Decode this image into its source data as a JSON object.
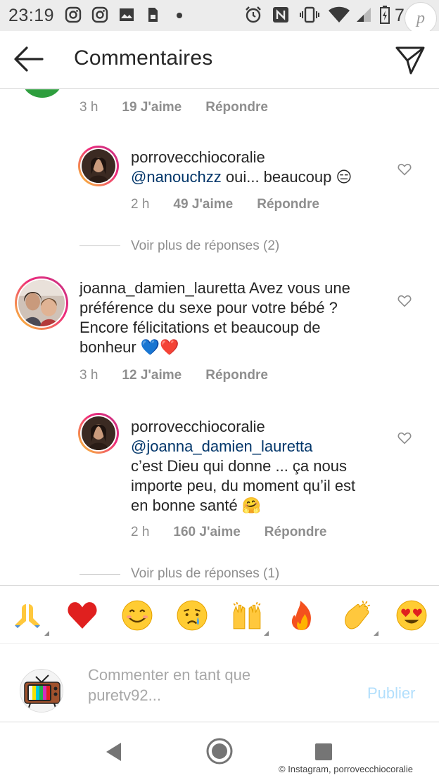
{
  "status_bar": {
    "time": "23:19",
    "battery_percent": "7",
    "icons": [
      "instagram-icon",
      "instagram-icon",
      "image-icon",
      "sim-icon",
      "dot-icon",
      "alarm-icon",
      "nfc-icon",
      "vibrate-icon",
      "wifi-icon",
      "signal-icon",
      "battery-icon"
    ],
    "watermark": "p"
  },
  "header": {
    "title": "Commentaires",
    "back_icon": "arrow-left-icon",
    "send_icon": "paper-plane-icon"
  },
  "comments": [
    {
      "kind": "partial",
      "time": "3 h",
      "likes": "19 J'aime",
      "reply": "Répondre"
    },
    {
      "kind": "reply",
      "username": "porrovecchiocoralie",
      "mention": "@nanouchzz",
      "text": " oui... beaucoup 😑",
      "time": "2 h",
      "likes": "49 J'aime",
      "reply": "Répondre"
    },
    {
      "kind": "more",
      "label": "Voir plus de réponses (2)"
    },
    {
      "kind": "top",
      "username": "joanna_damien_lauretta",
      "text_line1": " Avez vous une",
      "text_line2": "préférence du sexe pour votre bébé ?",
      "text_line3": "Encore félicitations et beaucoup de",
      "text_line4": "bonheur 💙❤️",
      "time": "3 h",
      "likes": "12 J'aime",
      "reply": "Répondre"
    },
    {
      "kind": "reply",
      "username": "porrovecchiocoralie",
      "mention": "@joanna_damien_lauretta",
      "text_line1": "c’est Dieu qui donne ... ça nous",
      "text_line2": "importe peu, du moment qu’il est",
      "text_line3": "en bonne santé 🤗",
      "time": "2 h",
      "likes": "160 J'aime",
      "reply": "Répondre"
    },
    {
      "kind": "more",
      "label": "Voir plus de réponses (1)"
    }
  ],
  "emoji_bar": [
    "🙏",
    "❤️",
    "😊",
    "😢",
    "🙌",
    "🔥",
    "👏",
    "😍"
  ],
  "composer": {
    "placeholder": "Commenter en tant que pure­tv92...",
    "placeholder_line1": "Commenter en tant que",
    "placeholder_line2": "puretv92...",
    "publish": "Publier",
    "avatar_icon": "retro-tv-icon"
  },
  "navbar": {
    "back": "nav-back-icon",
    "home": "nav-home-icon",
    "recents": "nav-recents-icon"
  },
  "credit": "© Instagram, porrovecchiocoralie",
  "colors": {
    "mention": "#003569",
    "meta": "#8e8e8e",
    "publish_disabled": "#b2dffc"
  }
}
